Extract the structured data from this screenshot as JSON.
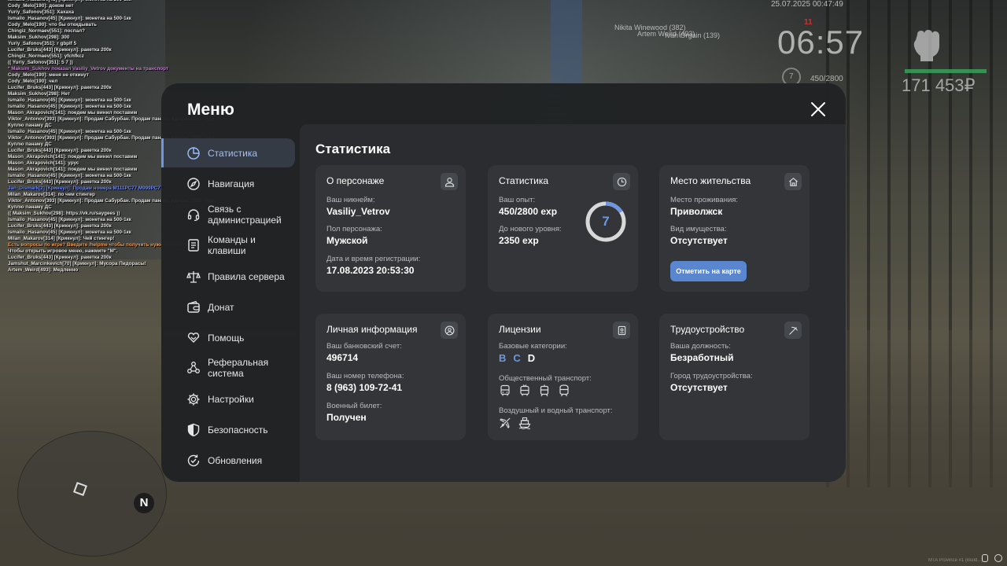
{
  "hud": {
    "datetime": "25.07.2025 00:47:49",
    "time": "06:57",
    "red_badge": "11",
    "nearby": [
      "Nikita Winewood (382)",
      "Artem Weird (493)",
      "Ivan Orgain (139)"
    ],
    "level": "7",
    "exp": "450/2800",
    "money": "171 453₽",
    "compass": "N",
    "server_info": "MTA Province #1 (Build...)"
  },
  "chat": [
    {
      "t": "Ismailo_Hasanov[45] [Крикнул]: монетка на 500-1кк",
      "c": ""
    },
    {
      "t": "Cody_Melo[190]: доком нет",
      "c": ""
    },
    {
      "t": "Yuriy_Safonov[351]: Хахаха",
      "c": ""
    },
    {
      "t": "Ismailo_Hasanov[45] [Крикнул]: монетка на 500-1кк",
      "c": ""
    },
    {
      "t": "Cody_Melo[190]: что бы откидывать",
      "c": ""
    },
    {
      "t": "Chingiz_Normaev[551]: поспал?",
      "c": ""
    },
    {
      "t": "Maksim_Sukhov[298]: 300",
      "c": ""
    },
    {
      "t": "Yuriy_Safonov[351]: r gbplf 5",
      "c": ""
    },
    {
      "t": "Lucifer_Bruks[443] [Крикнул]: ракетка 200к",
      "c": ""
    },
    {
      "t": "Chingiz_Normaev[551]: yfchfkcz",
      "c": ""
    },
    {
      "t": "(( Yuriy_Safonov[351]: 5 7 ))",
      "c": ""
    },
    {
      "t": "* Maksim_Sukhov показал Vasiliy_Vetrov документы на транспорт",
      "c": "purple"
    },
    {
      "t": "Cody_Melo[190]: меня не откинут",
      "c": ""
    },
    {
      "t": "Cody_Melo[190]: чел",
      "c": ""
    },
    {
      "t": "Lucifer_Bruks[443] [Крикнул]: ракетка 200к",
      "c": ""
    },
    {
      "t": "Maksim_Sukhov[298]: Нет",
      "c": ""
    },
    {
      "t": "Ismailo_Hasanov[45] [Крикнул]: монетка на 500-1кк",
      "c": ""
    },
    {
      "t": "Ismailo_Hasanov[45] [Крикнул]: монетка на 500-1кк",
      "c": ""
    },
    {
      "t": "Mason_Akrapovich[141]: поедем мы винил поставим",
      "c": ""
    },
    {
      "t": "Viktor_Antonov[393] [Крикнул]: Продам Сабурбан. Продам панаму Адидас 2023 года.",
      "c": ""
    },
    {
      "t": "  Куплю панаму ДС",
      "c": ""
    },
    {
      "t": "Ismailo_Hasanov[45] [Крикнул]: монетка на 500-1кк",
      "c": ""
    },
    {
      "t": "Viktor_Antonov[393] [Крикнул]: Продам Сабурбан. Продам панаму Адидас 2023 года.",
      "c": ""
    },
    {
      "t": "  Куплю панаму ДС",
      "c": ""
    },
    {
      "t": "Lucifer_Bruks[443] [Крикнул]: ракетка 200к",
      "c": ""
    },
    {
      "t": "Mason_Akrapovich[141]: поедем мы винил поставим",
      "c": ""
    },
    {
      "t": "Mason_Akrapovich[141]: урус",
      "c": ""
    },
    {
      "t": "Mason_Akrapovich[141]: поедем мы винил поставим",
      "c": ""
    },
    {
      "t": "Ismailo_Hasanov[45] [Крикнул]: монетка на 500-1кк",
      "c": ""
    },
    {
      "t": "Lucifer_Bruks[443] [Крикнул]: ракетка 200к",
      "c": ""
    },
    {
      "t": "Jan_Dismark[2] [Крикнул]: Продам номера М111РС77 М999РС77",
      "c": "blue"
    },
    {
      "t": "Milan_Makarov[314]: по чем стингер",
      "c": ""
    },
    {
      "t": "Viktor_Antonov[393] [Крикнул]: Продам Сабурбан. Продам панаму Адидас 2023 года.",
      "c": ""
    },
    {
      "t": "  Куплю панаму ДС",
      "c": ""
    },
    {
      "t": "(( Maksim_Sukhov[298]: https://vk.ru/saygees ))",
      "c": ""
    },
    {
      "t": "Ismailo_Hasanov[45] [Крикнул]: монетка на 500-1кк",
      "c": ""
    },
    {
      "t": "Lucifer_Bruks[443] [Крикнул]: ракетка 200к",
      "c": ""
    },
    {
      "t": "Ismailo_Hasanov[45] [Крикнул]: монетка на 500-1кк",
      "c": ""
    },
    {
      "t": "Milan_Makarov[314] [Крикнул]: Чей стингер!",
      "c": ""
    },
    {
      "t": "Есть вопросы по игре? Введите /helpme чтобы получить нужную информацию",
      "c": "orange"
    },
    {
      "t": "Чтобы открыть игровое меню, нажмите \"М\".",
      "c": ""
    },
    {
      "t": "Lucifer_Bruks[443] [Крикнул]: ракетка 200к",
      "c": ""
    },
    {
      "t": "Jamshut_Marcinkevich[70] [Крикнул]: Мусора Пидорасы!",
      "c": ""
    },
    {
      "t": "Artem_Weird[493]: Медленно",
      "c": ""
    }
  ],
  "menu": {
    "title": "Меню",
    "content_title": "Статистика",
    "sidebar": [
      {
        "label": "Статистика",
        "icon": "pie-chart-icon",
        "active": true
      },
      {
        "label": "Навигация",
        "icon": "compass-icon",
        "active": false
      },
      {
        "label": "Связь с администрацией",
        "icon": "headset-icon",
        "active": false
      },
      {
        "label": "Команды и клавиши",
        "icon": "keyboard-icon",
        "active": false
      },
      {
        "label": "Правила сервера",
        "icon": "scales-icon",
        "active": false
      },
      {
        "label": "Донат",
        "icon": "wallet-icon",
        "active": false
      },
      {
        "label": "Помощь",
        "icon": "heart-hands-icon",
        "active": false
      },
      {
        "label": "Реферальная система",
        "icon": "referral-icon",
        "active": false
      },
      {
        "label": "Настройки",
        "icon": "gear-icon",
        "active": false
      },
      {
        "label": "Безопасность",
        "icon": "shield-icon",
        "active": false
      },
      {
        "label": "Обновления",
        "icon": "update-check-icon",
        "active": false
      }
    ],
    "cards": {
      "character": {
        "title": "О персонаже",
        "nick_label": "Ваш никнейм:",
        "nick": "Vasiliy_Vetrov",
        "gender_label": "Пол персонажа:",
        "gender": "Мужской",
        "reg_label": "Дата и время регистрации:",
        "reg": "17.08.2023 20:53:30"
      },
      "stats": {
        "title": "Статистика",
        "exp_label": "Ваш опыт:",
        "exp": "450/2800 exp",
        "next_label": "До нового уровня:",
        "next": "2350 exp",
        "level": "7",
        "progress": 0.16
      },
      "residence": {
        "title": "Место жительства",
        "place_label": "Место проживания:",
        "place": "Приволжск",
        "property_label": "Вид имущества:",
        "property": "Отсутствует",
        "map_button": "Отметить на карте"
      },
      "personal": {
        "title": "Личная информация",
        "bank_label": "Ваш банковский счет:",
        "bank": "496714",
        "phone_label": "Ваш номер телефона:",
        "phone": "8 (963) 109-72-41",
        "military_label": "Военный билет:",
        "military": "Получен"
      },
      "licenses": {
        "title": "Лицензии",
        "base_label": "Базовые категории:",
        "categories": [
          {
            "name": "B",
            "owned": true
          },
          {
            "name": "C",
            "owned": true
          },
          {
            "name": "D",
            "owned": false
          }
        ],
        "public_label": "Общественный транспорт:",
        "air_label": "Воздушный и водный транспорт:"
      },
      "employment": {
        "title": "Трудоустройство",
        "position_label": "Ваша должность:",
        "position": "Безработный",
        "city_label": "Город трудоустройства:",
        "city": "Отсутствует"
      }
    }
  }
}
